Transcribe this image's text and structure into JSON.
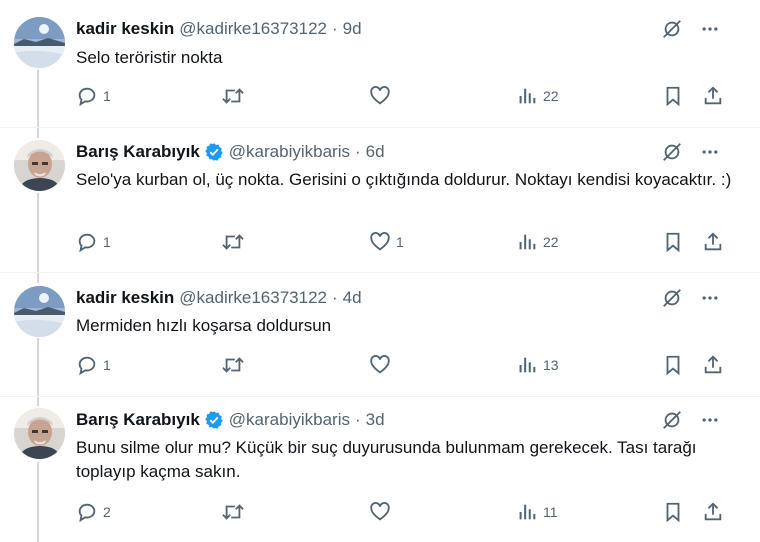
{
  "tweets": [
    {
      "name": "kadir keskin",
      "handle": "@kadirke16373122",
      "time": "9d",
      "verified": false,
      "avatar": "snow-landscape",
      "text": "Selo teröristir nokta",
      "replies": "1",
      "retweets": "",
      "likes": "",
      "views": "22"
    },
    {
      "name": "Barış Karabıyık",
      "handle": "@karabiyikbaris",
      "time": "6d",
      "verified": true,
      "avatar": "man-portrait",
      "text": "Selo'ya kurban ol, üç nokta. Gerisini o çıktığında doldurur. Noktayı kendisi koyacaktır. :)",
      "replies": "1",
      "retweets": "",
      "likes": "1",
      "views": "22"
    },
    {
      "name": "kadir keskin",
      "handle": "@kadirke16373122",
      "time": "4d",
      "verified": false,
      "avatar": "snow-landscape",
      "text": "Mermiden hızlı koşarsa doldursun",
      "replies": "1",
      "retweets": "",
      "likes": "",
      "views": "13"
    },
    {
      "name": "Barış Karabıyık",
      "handle": "@karabiyikbaris",
      "time": "3d",
      "verified": true,
      "avatar": "man-portrait",
      "text": "Bunu silme olur mu? Küçük bir suç duyurusunda bulunmam gerekecek. Tası tarağı toplayıp kaçma sakın.",
      "replies": "2",
      "retweets": "",
      "likes": "",
      "views": "11"
    }
  ],
  "colors": {
    "text": "#0f1419",
    "secondary": "#536471",
    "verified": "#1d9bf0",
    "line": "#cfd9de"
  }
}
